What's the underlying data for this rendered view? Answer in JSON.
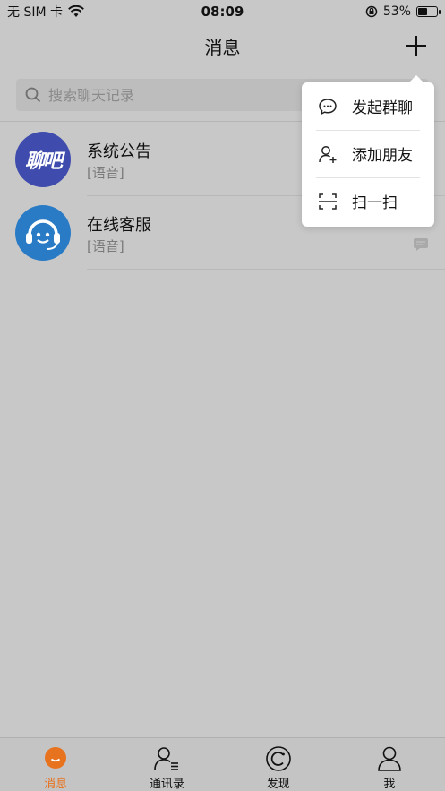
{
  "status_bar": {
    "carrier": "无 SIM 卡",
    "time": "08:09",
    "battery_percent_text": "53%",
    "battery_level": 0.53
  },
  "nav": {
    "title": "消息"
  },
  "search": {
    "placeholder": "搜索聊天记录"
  },
  "chats": [
    {
      "name": "系统公告",
      "preview": "[语音]",
      "avatar_text": "聊吧"
    },
    {
      "name": "在线客服",
      "preview": "[语音]"
    }
  ],
  "popup_menu": {
    "items": [
      {
        "label": "发起群聊",
        "icon": "chat-bubble-icon"
      },
      {
        "label": "添加朋友",
        "icon": "add-user-icon"
      },
      {
        "label": "扫一扫",
        "icon": "scan-icon"
      }
    ]
  },
  "tabs": [
    {
      "label": "消息",
      "icon": "message-icon",
      "active": true
    },
    {
      "label": "通讯录",
      "icon": "contacts-icon",
      "active": false
    },
    {
      "label": "发现",
      "icon": "discover-icon",
      "active": false
    },
    {
      "label": "我",
      "icon": "profile-icon",
      "active": false
    }
  ],
  "colors": {
    "accent": "#e8731e",
    "overlay_bg": "#c8c8c8",
    "avatar_system": "#3f4cad",
    "avatar_service": "#2a7bc6"
  }
}
